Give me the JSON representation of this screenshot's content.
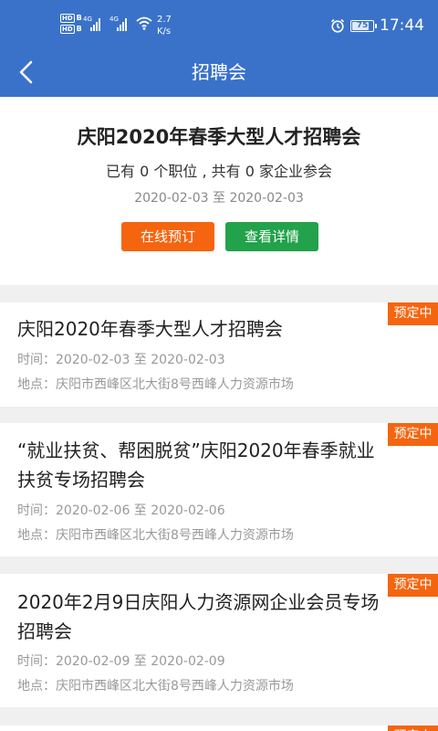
{
  "status_bar": {
    "hd1": "HD",
    "hd1_sub": "B",
    "hd2": "HD",
    "hd2_sub": "B",
    "sig1_tag": "4G",
    "sig2_tag": "4G",
    "speed_value": "2.7",
    "speed_unit": "K/s",
    "battery": "75",
    "time": "17:44"
  },
  "navbar": {
    "title": "招聘会"
  },
  "summary": {
    "title": "庆阳2020年春季大型人才招聘会",
    "stats": "已有 0 个职位 , 共有 0 家企业参会",
    "dates": "2020-02-03 至 2020-02-03",
    "book_button": "在线预订",
    "detail_button": "查看详情"
  },
  "labels": {
    "time_prefix": "时间：",
    "place_prefix": "地点："
  },
  "events": [
    {
      "badge": "预定中",
      "title": "庆阳2020年春季大型人才招聘会",
      "time": "2020-02-03 至 2020-02-03",
      "place": "庆阳市西峰区北大街8号西峰人力资源市场"
    },
    {
      "badge": "预定中",
      "title": "“就业扶贫、帮困脱贫”庆阳2020年春季就业扶贫专场招聘会",
      "time": "2020-02-06 至 2020-02-06",
      "place": "庆阳市西峰区北大街8号西峰人力资源市场"
    },
    {
      "badge": "预定中",
      "title": "2020年2月9日庆阳人力资源网企业会员专场招聘会",
      "time": "2020-02-09 至 2020-02-09",
      "place": "庆阳市西峰区北大街8号西峰人力资源市场"
    },
    {
      "badge": "预定中"
    }
  ],
  "colors": {
    "header": "#3a72c9",
    "accent_orange": "#f5650f",
    "accent_green": "#22a24a"
  },
  "icons": {
    "back": "chevron-left-icon",
    "wifi": "wifi-icon",
    "alarm": "alarm-icon",
    "battery": "battery-icon"
  }
}
